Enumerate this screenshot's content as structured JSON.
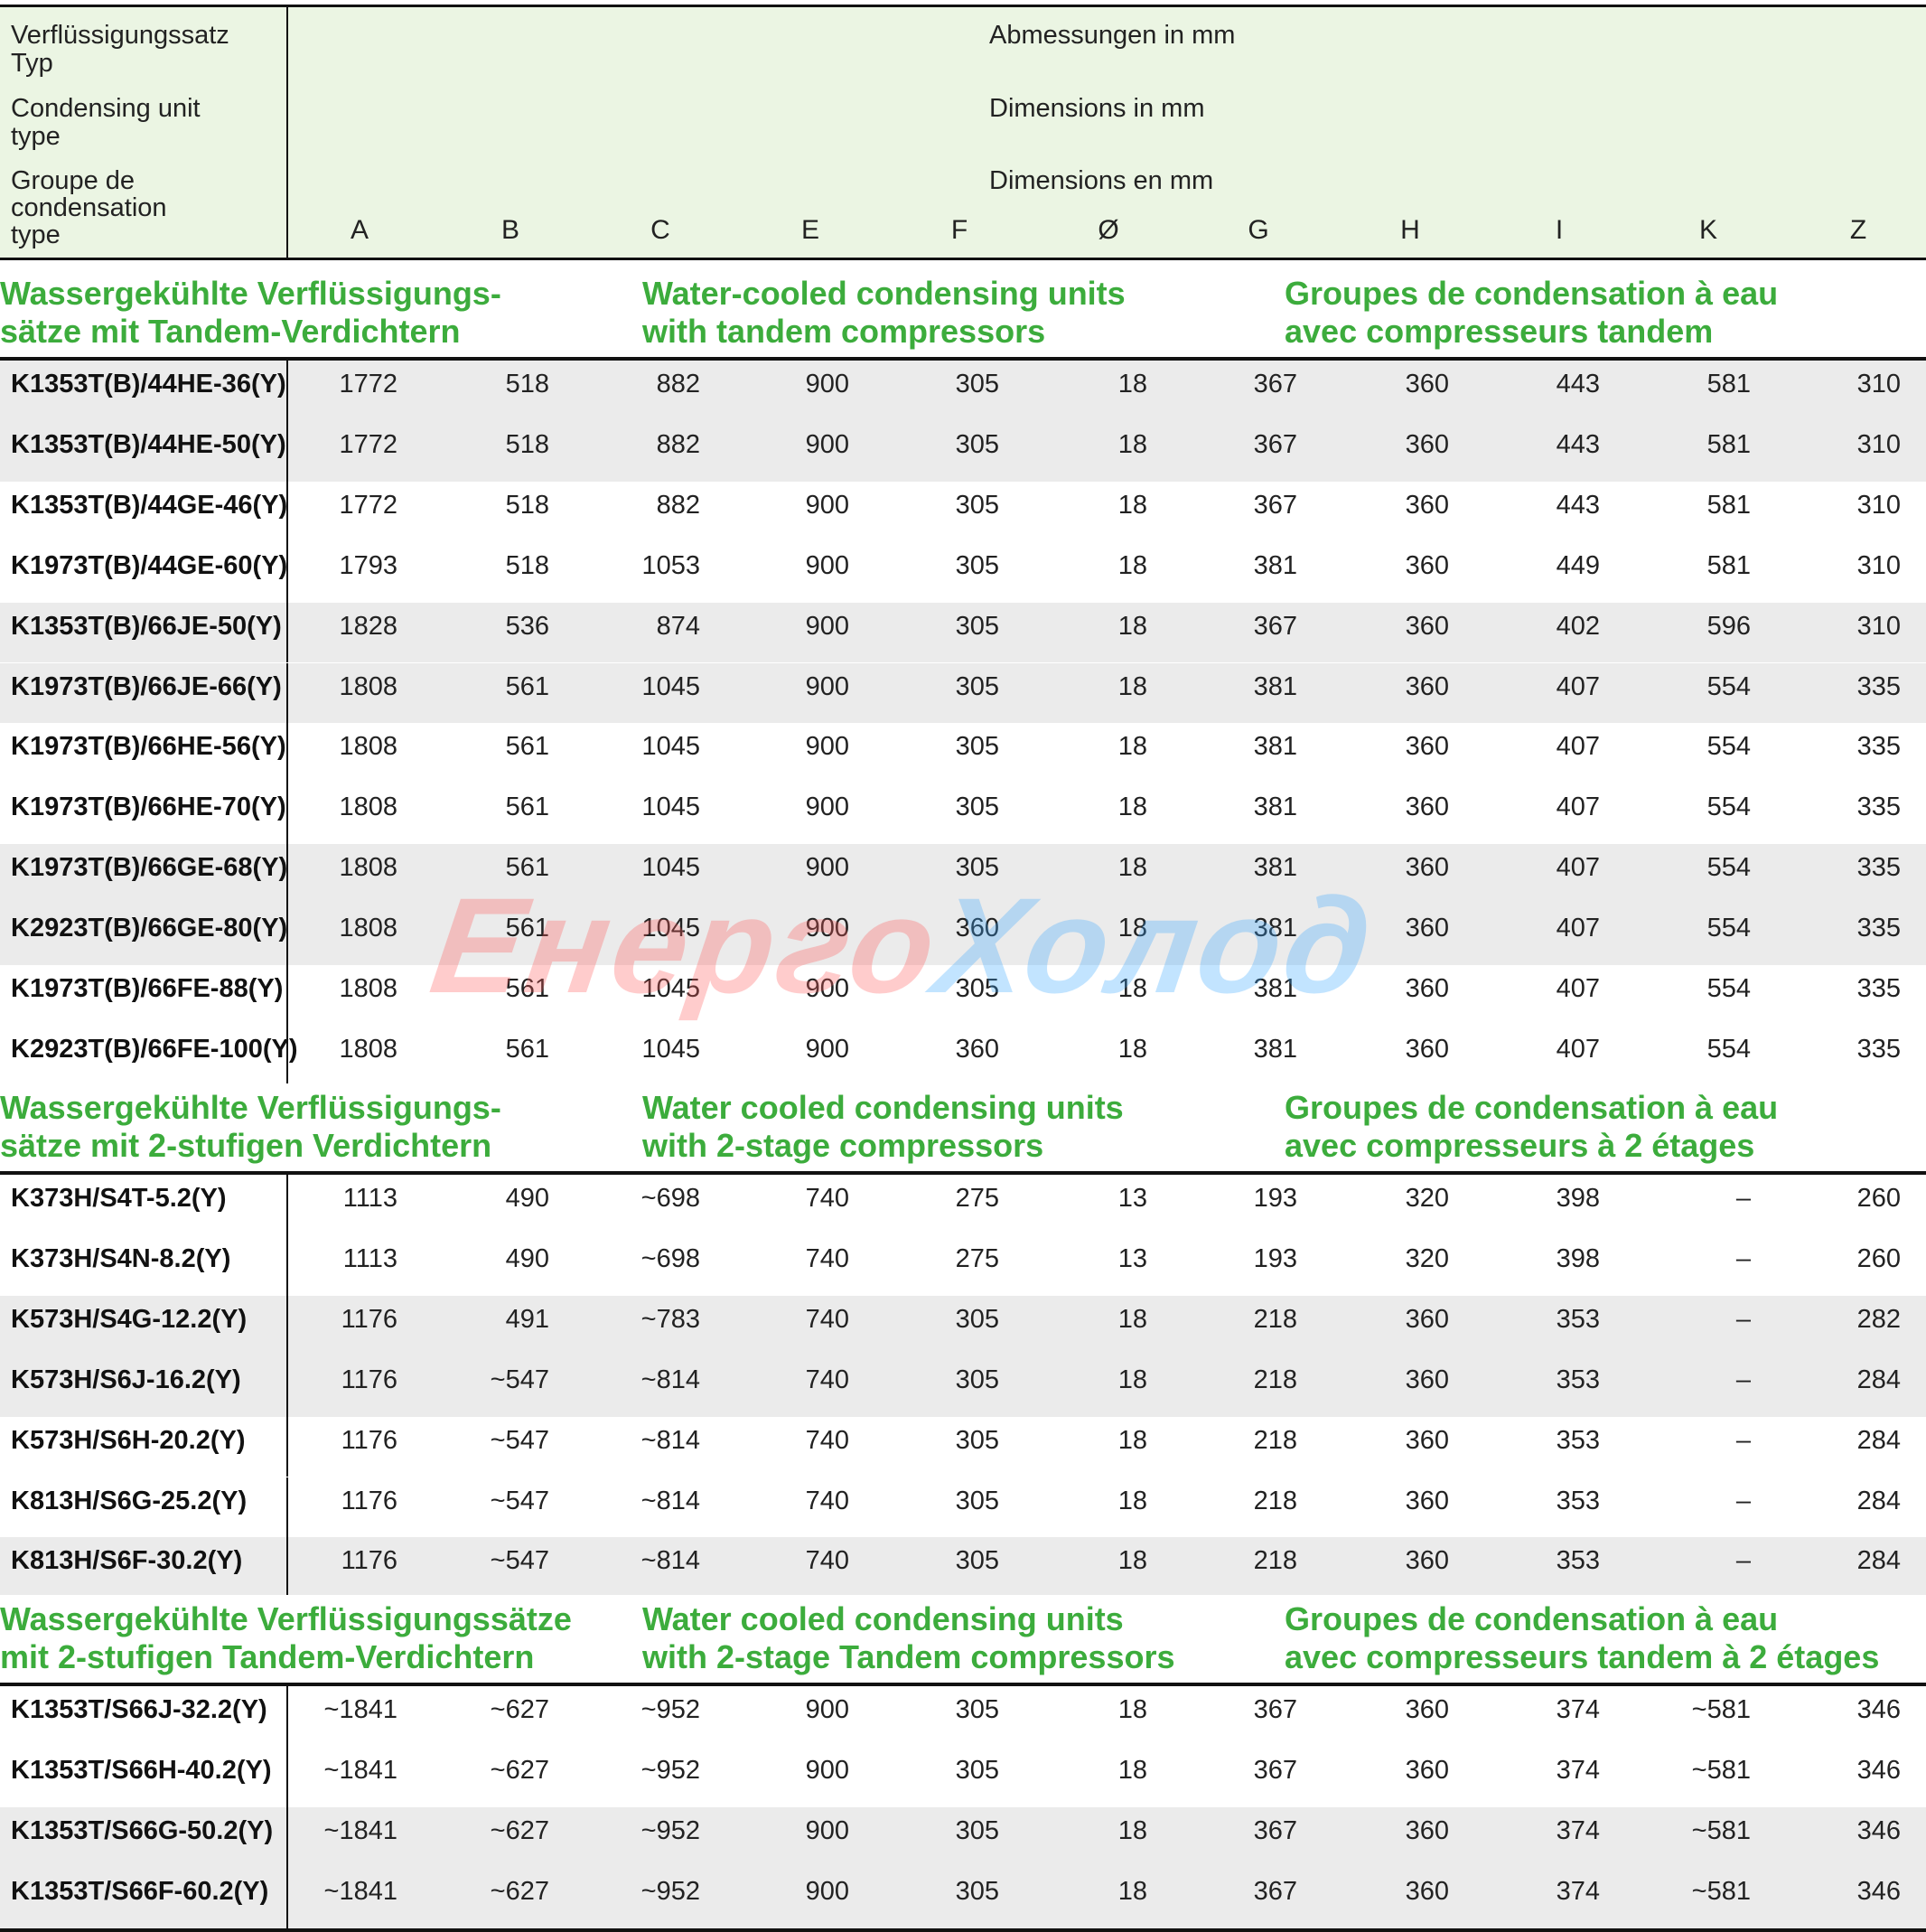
{
  "header": {
    "type_labels": [
      "Verflüssigungssatz",
      "Typ",
      "Condensing unit",
      "type",
      "Groupe de",
      "condensation",
      "type"
    ],
    "dim_labels": [
      "Abmessungen in mm",
      "Dimensions in mm",
      "Dimensions en mm"
    ],
    "columns": [
      "A",
      "B",
      "C",
      "E",
      "F",
      "Ø",
      "G",
      "H",
      "I",
      "K",
      "Z"
    ]
  },
  "sections": [
    {
      "title_de": [
        "Wassergekühlte Verflüssigungs-",
        "sätze mit Tandem-Verdichtern"
      ],
      "title_en": [
        "Water-cooled condensing units",
        "with tandem compressors"
      ],
      "title_fr": [
        "Groupes de condensation à eau",
        "avec compresseurs tandem"
      ],
      "rows": [
        {
          "model": "K1353T(B)/44HE-36(Y)",
          "values": [
            "1772",
            "518",
            "882",
            "900",
            "305",
            "18",
            "367",
            "360",
            "443",
            "581",
            "310"
          ]
        },
        {
          "model": "K1353T(B)/44HE-50(Y)",
          "values": [
            "1772",
            "518",
            "882",
            "900",
            "305",
            "18",
            "367",
            "360",
            "443",
            "581",
            "310"
          ]
        },
        {
          "model": "K1353T(B)/44GE-46(Y)",
          "values": [
            "1772",
            "518",
            "882",
            "900",
            "305",
            "18",
            "367",
            "360",
            "443",
            "581",
            "310"
          ]
        },
        {
          "model": "K1973T(B)/44GE-60(Y)",
          "values": [
            "1793",
            "518",
            "1053",
            "900",
            "305",
            "18",
            "381",
            "360",
            "449",
            "581",
            "310"
          ]
        },
        {
          "model": "K1353T(B)/66JE-50(Y)",
          "values": [
            "1828",
            "536",
            "874",
            "900",
            "305",
            "18",
            "367",
            "360",
            "402",
            "596",
            "310"
          ]
        },
        {
          "model": "K1973T(B)/66JE-66(Y)",
          "values": [
            "1808",
            "561",
            "1045",
            "900",
            "305",
            "18",
            "381",
            "360",
            "407",
            "554",
            "335"
          ]
        },
        {
          "model": "K1973T(B)/66HE-56(Y)",
          "values": [
            "1808",
            "561",
            "1045",
            "900",
            "305",
            "18",
            "381",
            "360",
            "407",
            "554",
            "335"
          ]
        },
        {
          "model": "K1973T(B)/66HE-70(Y)",
          "values": [
            "1808",
            "561",
            "1045",
            "900",
            "305",
            "18",
            "381",
            "360",
            "407",
            "554",
            "335"
          ]
        },
        {
          "model": "K1973T(B)/66GE-68(Y)",
          "values": [
            "1808",
            "561",
            "1045",
            "900",
            "305",
            "18",
            "381",
            "360",
            "407",
            "554",
            "335"
          ]
        },
        {
          "model": "K2923T(B)/66GE-80(Y)",
          "values": [
            "1808",
            "561",
            "1045",
            "900",
            "360",
            "18",
            "381",
            "360",
            "407",
            "554",
            "335"
          ]
        },
        {
          "model": "K1973T(B)/66FE-88(Y)",
          "values": [
            "1808",
            "561",
            "1045",
            "900",
            "305",
            "18",
            "381",
            "360",
            "407",
            "554",
            "335"
          ]
        },
        {
          "model": "K2923T(B)/66FE-100(Y)",
          "values": [
            "1808",
            "561",
            "1045",
            "900",
            "360",
            "18",
            "381",
            "360",
            "407",
            "554",
            "335"
          ]
        }
      ]
    },
    {
      "title_de": [
        "Wassergekühlte Verflüssigungs-",
        "sätze mit 2-stufigen Verdichtern"
      ],
      "title_en": [
        "Water cooled condensing units",
        "with 2-stage compressors"
      ],
      "title_fr": [
        "Groupes de condensation à eau",
        "avec compresseurs à 2 étages"
      ],
      "rows": [
        {
          "model": "K373H/S4T-5.2(Y)",
          "values": [
            "1113",
            "490",
            "~698",
            "740",
            "275",
            "13",
            "193",
            "320",
            "398",
            "–",
            "260"
          ]
        },
        {
          "model": "K373H/S4N-8.2(Y)",
          "values": [
            "1113",
            "490",
            "~698",
            "740",
            "275",
            "13",
            "193",
            "320",
            "398",
            "–",
            "260"
          ]
        },
        {
          "model": "K573H/S4G-12.2(Y)",
          "values": [
            "1176",
            "491",
            "~783",
            "740",
            "305",
            "18",
            "218",
            "360",
            "353",
            "–",
            "282"
          ]
        },
        {
          "model": "K573H/S6J-16.2(Y)",
          "values": [
            "1176",
            "~547",
            "~814",
            "740",
            "305",
            "18",
            "218",
            "360",
            "353",
            "–",
            "284"
          ]
        },
        {
          "model": "K573H/S6H-20.2(Y)",
          "values": [
            "1176",
            "~547",
            "~814",
            "740",
            "305",
            "18",
            "218",
            "360",
            "353",
            "–",
            "284"
          ]
        },
        {
          "model": "K813H/S6G-25.2(Y)",
          "values": [
            "1176",
            "~547",
            "~814",
            "740",
            "305",
            "18",
            "218",
            "360",
            "353",
            "–",
            "284"
          ]
        },
        {
          "model": "K813H/S6F-30.2(Y)",
          "values": [
            "1176",
            "~547",
            "~814",
            "740",
            "305",
            "18",
            "218",
            "360",
            "353",
            "–",
            "284"
          ]
        }
      ]
    },
    {
      "title_de": [
        "Wassergekühlte Verflüssigungssätze",
        "mit 2-stufigen Tandem-Verdichtern"
      ],
      "title_en": [
        "Water cooled condensing units",
        "with 2-stage Tandem compressors"
      ],
      "title_fr": [
        "Groupes de condensation à eau",
        "avec compresseurs tandem à 2 étages"
      ],
      "rows": [
        {
          "model": "K1353T/S66J-32.2(Y)",
          "values": [
            "~1841",
            "~627",
            "~952",
            "900",
            "305",
            "18",
            "367",
            "360",
            "374",
            "~581",
            "346"
          ]
        },
        {
          "model": "K1353T/S66H-40.2(Y)",
          "values": [
            "~1841",
            "~627",
            "~952",
            "900",
            "305",
            "18",
            "367",
            "360",
            "374",
            "~581",
            "346"
          ]
        },
        {
          "model": "K1353T/S66G-50.2(Y)",
          "values": [
            "~1841",
            "~627",
            "~952",
            "900",
            "305",
            "18",
            "367",
            "360",
            "374",
            "~581",
            "346"
          ]
        },
        {
          "model": "K1353T/S66F-60.2(Y)",
          "values": [
            "~1841",
            "~627",
            "~952",
            "900",
            "305",
            "18",
            "367",
            "360",
            "374",
            "~581",
            "346"
          ]
        }
      ]
    }
  ],
  "watermark": {
    "part1": "Енерго",
    "part2": "Холод"
  },
  "colors": {
    "accent": "#3cac3c",
    "header_bg": "#ebf5e3",
    "row_shade": "#ebebeb"
  }
}
